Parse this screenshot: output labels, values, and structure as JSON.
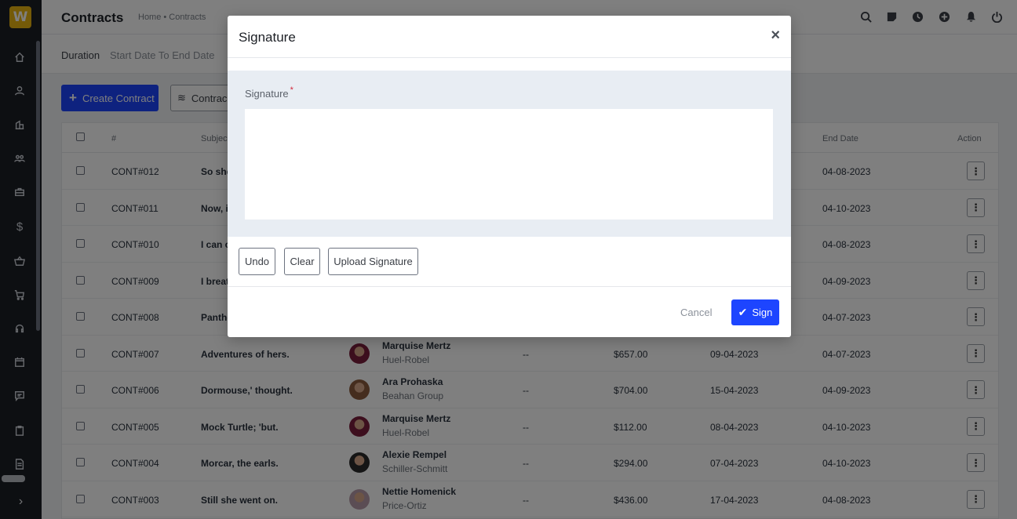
{
  "app": {
    "logo_letter": "W"
  },
  "header": {
    "title": "Contracts",
    "breadcrumb": "Home • Contracts"
  },
  "filter": {
    "label": "Duration",
    "value": "Start Date To End Date"
  },
  "actions": {
    "create_label": "Create Contract",
    "contract_template_label": "Contrac"
  },
  "table": {
    "headers": {
      "num": "#",
      "subject": "Subjec",
      "end_date": "End Date",
      "action": "Action"
    },
    "rows": [
      {
        "id": "CONT#012",
        "subject": "So she",
        "client": "",
        "company": "",
        "value": "",
        "start": "",
        "end": "04-08-2023",
        "amount": ""
      },
      {
        "id": "CONT#011",
        "subject": "Now, i",
        "client": "",
        "company": "",
        "value": "",
        "start": "",
        "end": "04-10-2023",
        "amount": ""
      },
      {
        "id": "CONT#010",
        "subject": "I can c",
        "client": "",
        "company": "",
        "value": "",
        "start": "",
        "end": "04-08-2023",
        "amount": ""
      },
      {
        "id": "CONT#009",
        "subject": "I breat",
        "client": "",
        "company": "",
        "value": "",
        "start": "",
        "end": "04-09-2023",
        "amount": ""
      },
      {
        "id": "CONT#008",
        "subject": "Panthe",
        "client": "",
        "company": "",
        "value": "",
        "start": "",
        "end": "04-07-2023",
        "amount": ""
      },
      {
        "id": "CONT#007",
        "subject": "Adventures of hers.",
        "client": "Marquise Mertz",
        "company": "Huel-Robel",
        "value": "--",
        "amount": "$657.00",
        "start": "09-04-2023",
        "end": "04-07-2023"
      },
      {
        "id": "CONT#006",
        "subject": "Dormouse,' thought.",
        "client": "Ara Prohaska",
        "company": "Beahan Group",
        "value": "--",
        "amount": "$704.00",
        "start": "15-04-2023",
        "end": "04-09-2023"
      },
      {
        "id": "CONT#005",
        "subject": "Mock Turtle; 'but.",
        "client": "Marquise Mertz",
        "company": "Huel-Robel",
        "value": "--",
        "amount": "$112.00",
        "start": "08-04-2023",
        "end": "04-10-2023"
      },
      {
        "id": "CONT#004",
        "subject": "Morcar, the earls.",
        "client": "Alexie Rempel",
        "company": "Schiller-Schmitt",
        "value": "--",
        "amount": "$294.00",
        "start": "07-04-2023",
        "end": "04-10-2023"
      },
      {
        "id": "CONT#003",
        "subject": "Still she went on.",
        "client": "Nettie Homenick",
        "company": "Price-Ortiz",
        "value": "--",
        "amount": "$436.00",
        "start": "17-04-2023",
        "end": "04-08-2023"
      }
    ]
  },
  "modal": {
    "title": "Signature",
    "close_glyph": "×",
    "field_label": "Signature",
    "required_mark": "*",
    "undo_label": "Undo",
    "clear_label": "Clear",
    "upload_label": "Upload Signature",
    "cancel_label": "Cancel",
    "sign_label": "Sign"
  },
  "colors": {
    "primary": "#1d45ff",
    "sidebar": "#1b1e24",
    "logo": "#e9b410"
  }
}
